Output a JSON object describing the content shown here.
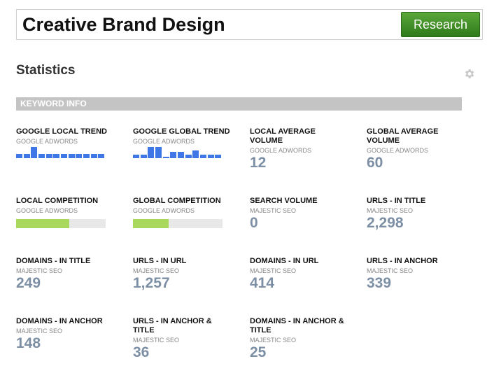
{
  "search": {
    "value": "Creative Brand Design",
    "button_label": "Research"
  },
  "page_title": "Statistics",
  "section_label": "KEYWORD INFO",
  "stats": {
    "google_local_trend": {
      "label": "GOOGLE LOCAL TREND",
      "source": "GOOGLE ADWORDS",
      "trend": [
        3,
        3,
        8,
        3,
        3,
        3,
        3,
        3,
        3,
        3,
        3,
        3
      ]
    },
    "google_global_trend": {
      "label": "GOOGLE GLOBAL TREND",
      "source": "GOOGLE ADWORDS",
      "trend": [
        3,
        3,
        9,
        9,
        1,
        5,
        5,
        3,
        6,
        3,
        3,
        3
      ]
    },
    "local_average_volume": {
      "label": "LOCAL AVERAGE VOLUME",
      "source": "GOOGLE ADWORDS",
      "value": "12"
    },
    "global_average_volume": {
      "label": "GLOBAL AVERAGE VOLUME",
      "source": "GOOGLE ADWORDS",
      "value": "60"
    },
    "local_competition": {
      "label": "LOCAL COMPETITION",
      "source": "GOOGLE ADWORDS",
      "level": 0.59
    },
    "global_competition": {
      "label": "GLOBAL COMPETITION",
      "source": "GOOGLE ADWORDS",
      "level": 0.4
    },
    "search_volume": {
      "label": "SEARCH VOLUME",
      "source": "MAJESTIC SEO",
      "value": "0"
    },
    "urls_in_title": {
      "label": "URLS - IN TITLE",
      "source": "MAJESTIC SEO",
      "value": "2,298"
    },
    "domains_in_title": {
      "label": "DOMAINS - IN TITLE",
      "source": "MAJESTIC SEO",
      "value": "249"
    },
    "urls_in_url": {
      "label": "URLS - IN URL",
      "source": "MAJESTIC SEO",
      "value": "1,257"
    },
    "domains_in_url": {
      "label": "DOMAINS - IN URL",
      "source": "MAJESTIC SEO",
      "value": "414"
    },
    "urls_in_anchor": {
      "label": "URLS - IN ANCHOR",
      "source": "MAJESTIC SEO",
      "value": "339"
    },
    "domains_in_anchor": {
      "label": "DOMAINS - IN ANCHOR",
      "source": "MAJESTIC SEO",
      "value": "148"
    },
    "urls_in_anchor_title": {
      "label": "URLS - IN ANCHOR & TITLE",
      "source": "MAJESTIC SEO",
      "value": "36"
    },
    "domains_in_anchor_title": {
      "label": "DOMAINS - IN ANCHOR & TITLE",
      "source": "MAJESTIC SEO",
      "value": "25"
    }
  },
  "colors": {
    "trend_bar": "#3f78e6",
    "competition_fill": "#a8d85c",
    "value_text": "#7d8fa4",
    "research_button": "#3f8f25"
  },
  "icons": {
    "settings": "gear-icon"
  }
}
